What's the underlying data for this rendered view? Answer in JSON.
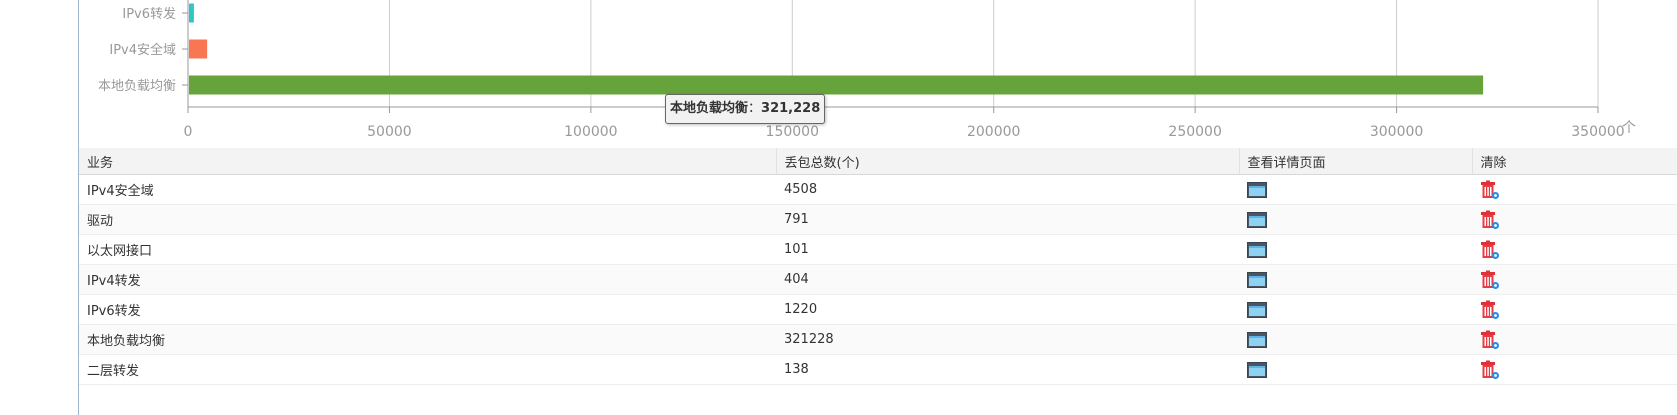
{
  "chart_data": {
    "type": "bar",
    "orientation": "horizontal",
    "categories_visible": [
      "IPv6转发",
      "IPv4安全域",
      "本地负载均衡"
    ],
    "values": [
      1220,
      4508,
      321228
    ],
    "colors": [
      "#2ec7c9",
      "#f87652",
      "#67a33b"
    ],
    "xlim": [
      0,
      350000
    ],
    "x_ticks": [
      "0",
      "50000",
      "100000",
      "150000",
      "200000",
      "250000",
      "300000",
      "350000"
    ],
    "x_unit": "个",
    "grid": true
  },
  "tooltip": {
    "category": "本地负载均衡",
    "separator": "：",
    "value": "321,228"
  },
  "table": {
    "headers": [
      "业务",
      "丢包总数(个)",
      "查看详情页面",
      "清除"
    ],
    "rows": [
      {
        "service": "IPv4安全域",
        "drops": "4508"
      },
      {
        "service": "驱动",
        "drops": "791"
      },
      {
        "service": "以太网接口",
        "drops": "101"
      },
      {
        "service": "IPv4转发",
        "drops": "404"
      },
      {
        "service": "IPv6转发",
        "drops": "1220"
      },
      {
        "service": "本地负载均衡",
        "drops": "321228"
      },
      {
        "service": "二层转发",
        "drops": "138"
      }
    ]
  },
  "icons": {
    "view": "window-view-icon",
    "clear": "trash-clear-icon"
  }
}
